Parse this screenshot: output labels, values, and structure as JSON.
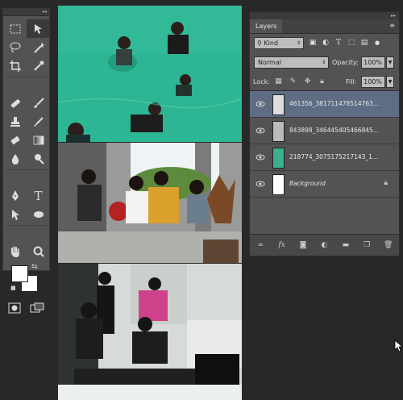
{
  "tools_panel": {
    "collapse_label": "◂◂",
    "tools": [
      "move",
      "marquee",
      "lasso",
      "magic-wand",
      "crop",
      "eyedropper",
      "healing-brush",
      "brush",
      "clone-stamp",
      "history-brush",
      "eraser",
      "gradient",
      "blur",
      "dodge",
      "pen",
      "type",
      "path-selection",
      "shape",
      "hand",
      "zoom"
    ],
    "type_glyph": "T"
  },
  "layers_panel": {
    "collapse_label": "▸▸",
    "tab_label": "Layers",
    "kind_label": "Kind",
    "filter_icons": [
      "image-filter",
      "adjustment-filter",
      "type-filter",
      "shape-filter",
      "smart-object-filter"
    ],
    "blend_mode": "Normal",
    "opacity_label": "Opacity:",
    "opacity_value": "100%",
    "lock_label": "Lock:",
    "fill_label": "Fill:",
    "fill_value": "100%",
    "layers": [
      {
        "name": "461356_381711478514763...",
        "visible": true,
        "selected": true
      },
      {
        "name": "843898_346445405466845...",
        "visible": true,
        "selected": false
      },
      {
        "name": "218774_3075175217143_1...",
        "visible": true,
        "selected": false
      },
      {
        "name": "Background",
        "visible": true,
        "selected": false,
        "locked": true
      }
    ],
    "footer_icons": [
      "link-icon",
      "fx-icon",
      "mask-icon",
      "adjustment-icon",
      "folder-icon",
      "new-layer-icon",
      "trash-icon"
    ],
    "fx_label": "fx"
  },
  "colors": {
    "panel": "#535353",
    "selected_layer": "#5e6d84",
    "background": "#282828"
  }
}
